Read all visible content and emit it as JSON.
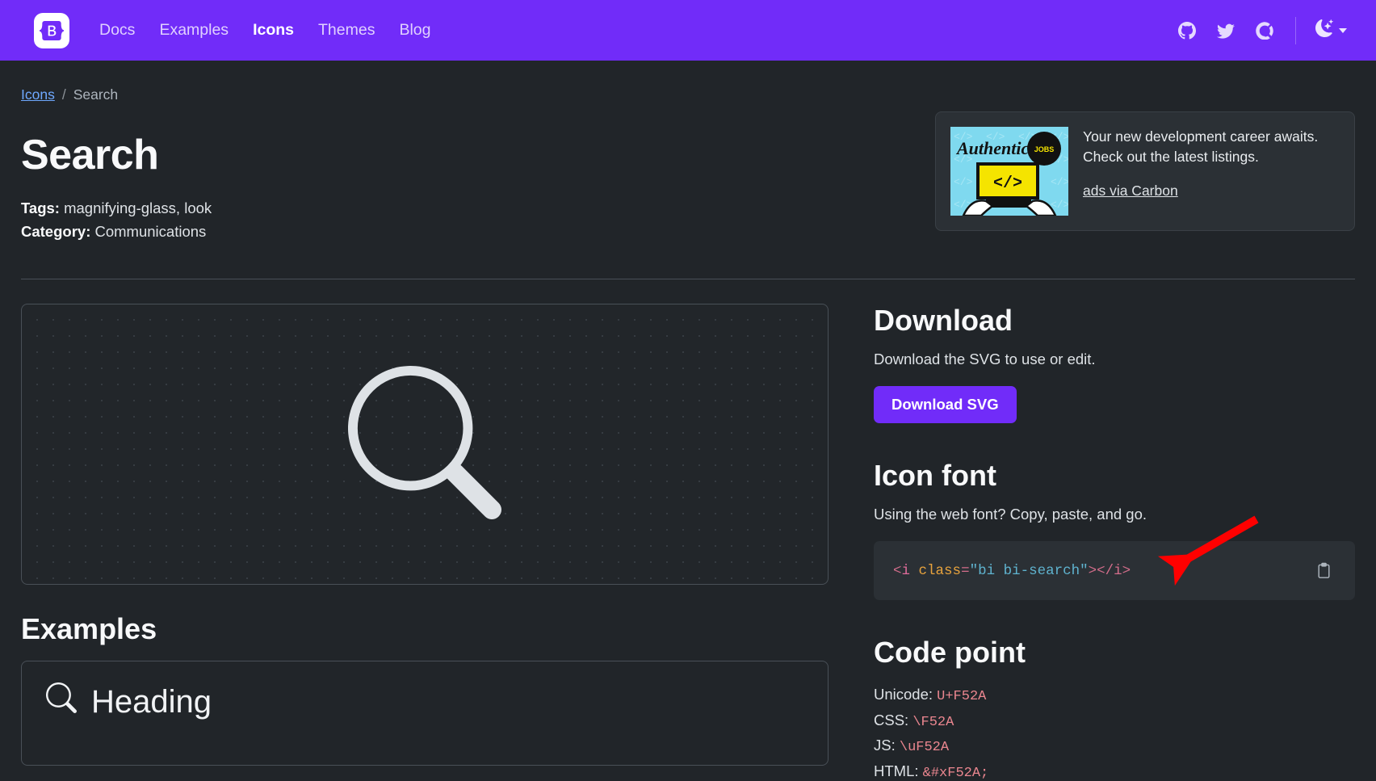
{
  "navbar": {
    "brand_name": "bootstrap-logo",
    "links": [
      {
        "label": "Docs",
        "active": false
      },
      {
        "label": "Examples",
        "active": false
      },
      {
        "label": "Icons",
        "active": true
      },
      {
        "label": "Themes",
        "active": false
      },
      {
        "label": "Blog",
        "active": false
      }
    ],
    "social": [
      {
        "name": "github-icon"
      },
      {
        "name": "twitter-icon"
      },
      {
        "name": "open-collective-icon"
      }
    ],
    "theme_toggle_label": "moon-stars",
    "brand_color": "#712cf9"
  },
  "breadcrumb": {
    "parent": "Icons",
    "separator": "/",
    "current": "Search"
  },
  "header": {
    "title": "Search",
    "tags_label": "Tags:",
    "tags_value": "magnifying-glass, look",
    "category_label": "Category:",
    "category_value": "Communications"
  },
  "ad": {
    "image_brand": "Authentic",
    "image_badge": "JOBS",
    "line1": "Your new development career awaits.",
    "line2": "Check out the latest listings.",
    "link": "ads via Carbon"
  },
  "preview": {
    "icon_name": "search-icon"
  },
  "examples": {
    "title": "Examples",
    "heading_text": "Heading"
  },
  "download": {
    "title": "Download",
    "description": "Download the SVG to use or edit.",
    "button_label": "Download SVG"
  },
  "icon_font": {
    "title": "Icon font",
    "description": "Using the web font? Copy, paste, and go.",
    "code_parts": {
      "open_angle": "<",
      "tag": "i",
      "space": " ",
      "attr": "class",
      "equals": "=",
      "value": "\"bi bi-search\"",
      "close_angle": ">",
      "close_tag": "</i>"
    },
    "code_full": "<i class=\"bi bi-search\"></i>",
    "copy_label": "clipboard-icon"
  },
  "code_point": {
    "title": "Code point",
    "rows": [
      {
        "label": "Unicode:",
        "value": "U+F52A"
      },
      {
        "label": "CSS:",
        "value": "\\F52A"
      },
      {
        "label": "JS:",
        "value": "\\uF52A"
      },
      {
        "label": "HTML:",
        "value": "&#xF52A;"
      }
    ]
  },
  "annotation": {
    "arrow_color": "#ff0000",
    "points_to": "icon-font-code-snippet"
  }
}
